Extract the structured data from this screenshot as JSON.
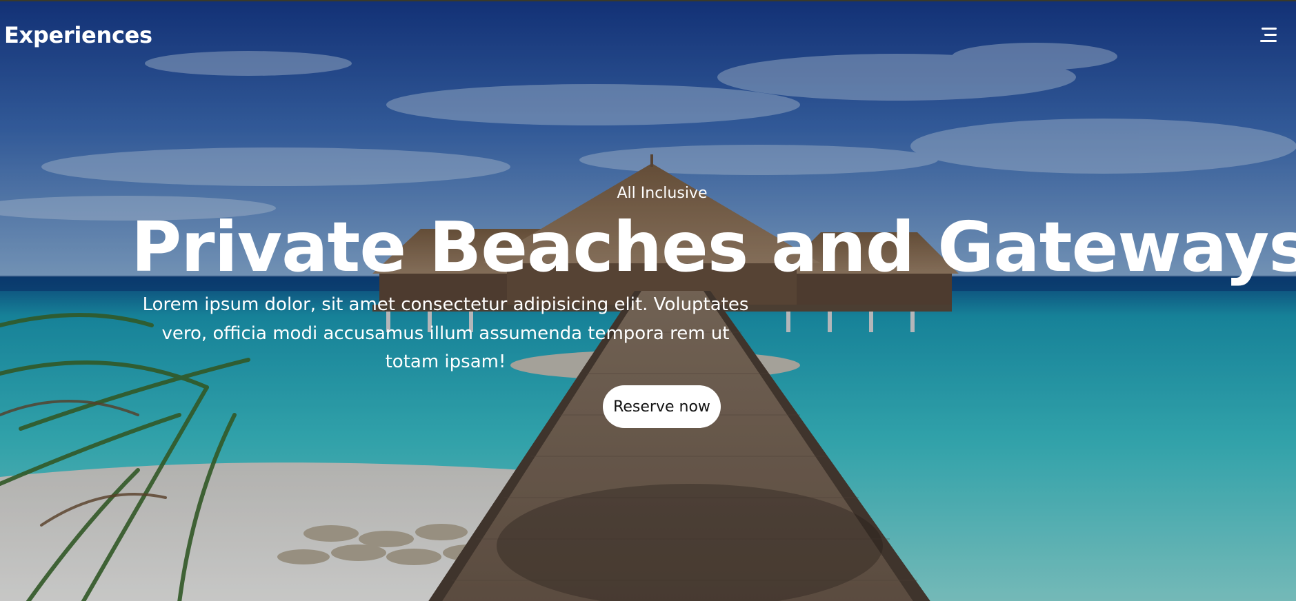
{
  "header": {
    "brand": "Experiences",
    "menu_icon": "hamburger-menu-icon"
  },
  "hero": {
    "eyebrow": "All Inclusive",
    "headline": "Private Beaches and Gateways",
    "lede": "Lorem ipsum dolor, sit amet consectetur adipisicing elit. Voluptates vero, officia modi accusamus illum assumenda tempora rem ut totam ipsam!",
    "cta_label": "Reserve now"
  },
  "colors": {
    "sky": "#1b3f8c",
    "sea": "#2fb8c4",
    "sand": "#e9e5dc",
    "text": "#ffffff",
    "button_bg": "#ffffff",
    "button_text": "#111111"
  }
}
